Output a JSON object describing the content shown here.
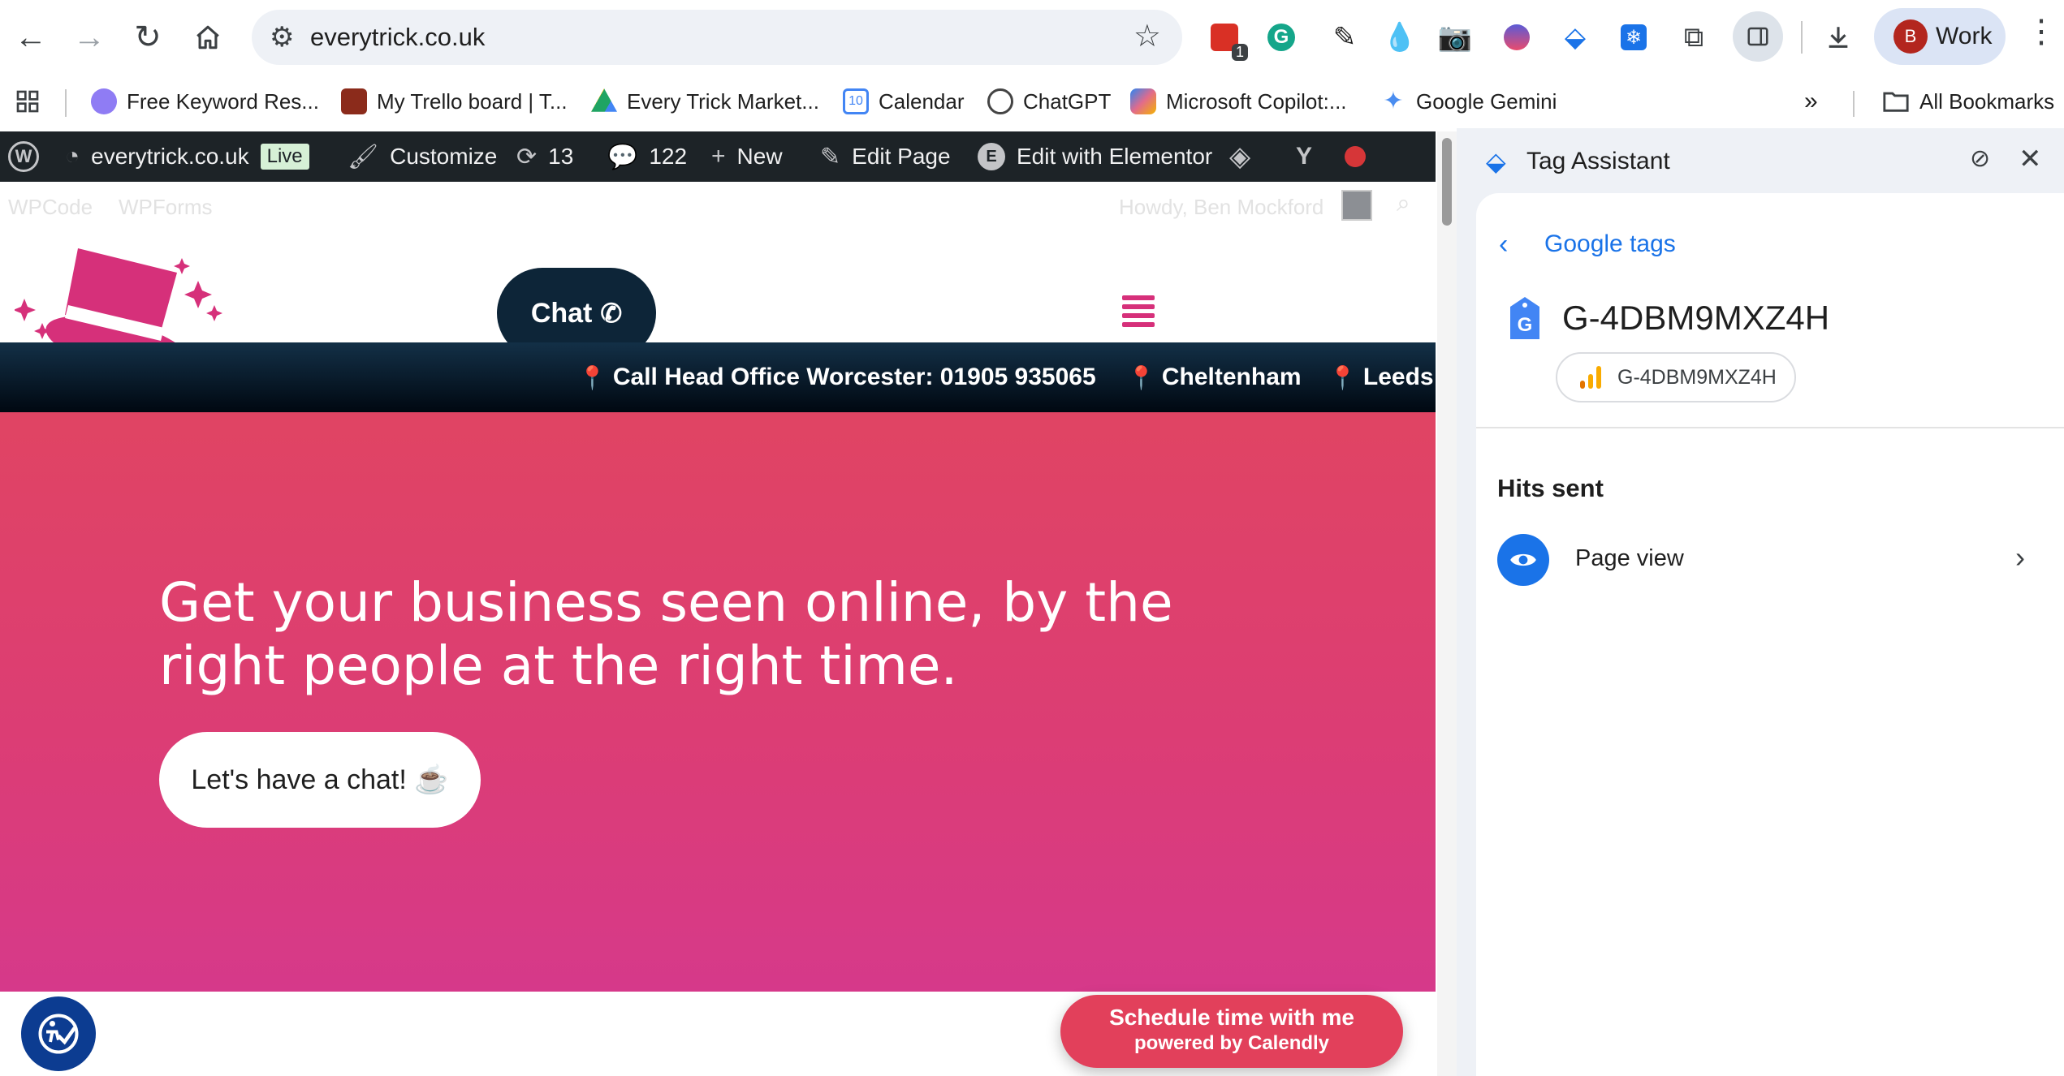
{
  "browser": {
    "url": "everytrick.co.uk",
    "ext_badge": "1",
    "profile_initial": "B",
    "profile_label": "Work",
    "icons": {
      "back": "arrow-left-icon",
      "forward": "arrow-right-icon",
      "reload": "reload-icon",
      "home": "home-icon",
      "site_settings": "tune-icon",
      "star": "star-icon",
      "download": "download-icon",
      "menu": "more-vert-icon"
    }
  },
  "bookmarks": {
    "items": [
      {
        "label": "Free Keyword Res...",
        "icon": "keyword-tool-icon",
        "color": "#7c6cf2"
      },
      {
        "label": "My Trello board | T...",
        "icon": "trello-icon",
        "color": "#8b2b1b"
      },
      {
        "label": "Every Trick Market...",
        "icon": "google-drive-icon",
        "color": "#1fa463"
      },
      {
        "label": "Calendar",
        "icon": "calendar-icon",
        "color": "#4285f4"
      },
      {
        "label": "ChatGPT",
        "icon": "chatgpt-icon",
        "color": "#444444"
      },
      {
        "label": "Microsoft Copilot:...",
        "icon": "copilot-icon",
        "color": "#e26b8b"
      },
      {
        "label": "Google Gemini",
        "icon": "gemini-icon",
        "color": "#4a8df0"
      }
    ],
    "overflow": "»",
    "all_bookmarks": "All Bookmarks"
  },
  "wp_admin_bar": {
    "site": "everytrick.co.uk",
    "live_badge": "Live",
    "customize": "Customize",
    "updates_count": "13",
    "comments_count": "122",
    "new": "New",
    "edit_page": "Edit Page",
    "edit_elementor": "Edit with Elementor"
  },
  "site": {
    "faint_links": [
      "WPCode",
      "WPForms"
    ],
    "howdy": "Howdy, Ben Mockford",
    "chat_button": "Chat",
    "contact": {
      "head_office": "Call Head Office Worcester: 01905 935065",
      "cheltenham": "Cheltenham",
      "leeds": "Leeds"
    },
    "hero": {
      "title": "Get your business seen online, by the right people at the right time.",
      "cta": "Let's have a chat! ☕"
    },
    "calendly": {
      "line1": "Schedule time with me",
      "line2": "powered by Calendly"
    },
    "colors": {
      "brand_pink": "#d6307a",
      "navy": "#0d2538",
      "hero_top": "#e04463",
      "hero_bottom": "#d6398a",
      "calendly": "#e2405b"
    }
  },
  "tag_assistant": {
    "title": "Tag Assistant",
    "breadcrumb": "Google tags",
    "tag_id": "G-4DBM9MXZ4H",
    "chip_label": "G-4DBM9MXZ4H",
    "hits_heading": "Hits sent",
    "hits": [
      {
        "label": "Page view",
        "icon": "eye-icon"
      }
    ]
  }
}
